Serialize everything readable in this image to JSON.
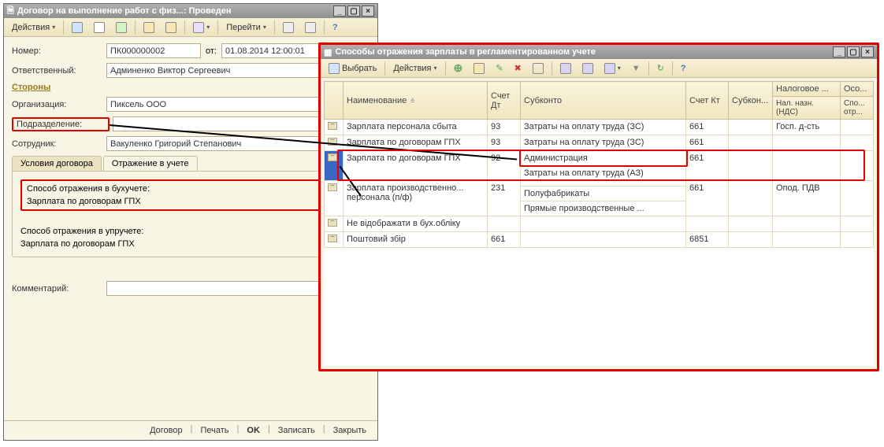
{
  "window1": {
    "title": "Договор на выполнение работ с физ...: Проведен",
    "toolbar": {
      "actions": "Действия",
      "goto": "Перейти"
    },
    "number_label": "Номер:",
    "number_value": "ПК000000002",
    "ot_label": "от:",
    "date_value": "01.08.2014 12:00:01",
    "responsible_label": "Ответственный:",
    "responsible_value": "Админенко Виктор Сергеевич",
    "sides_label": "Стороны",
    "org_label": "Организация:",
    "org_value": "Пиксель ООО",
    "dept_label": "Подразделение:",
    "dept_value": "",
    "emp_label": "Сотрудник:",
    "emp_value": "Вакуленко Григорий Степанович",
    "tab1": "Условия договора",
    "tab2": "Отражение в учете",
    "acc_method_label": "Способ отражения в бухучете:",
    "acc_method_value": "Зарплата по договорам ГПХ",
    "mgmt_method_label": "Способ отражения в упручете:",
    "mgmt_method_value": "Зарплата по договорам ГПХ",
    "comment_label": "Комментарий:",
    "comment_value": "",
    "footer": {
      "dogovor": "Договор",
      "print": "Печать",
      "ok": "OK",
      "write": "Записать",
      "close": "Закрыть"
    }
  },
  "window2": {
    "title": "Способы отражения зарплаты в регламентированном учете",
    "toolbar": {
      "choose": "Выбрать",
      "actions": "Действия"
    },
    "headers": {
      "name": "Наименование",
      "dt": "Счет Дт",
      "sub": "Субконто",
      "kt": "Счет Кт",
      "subkt": "Субкон...",
      "tax": "Налоговое ...",
      "oso": "Осо...",
      "nds": "Нал. назн. (НДС)",
      "spo": "Спо... отр..."
    },
    "rows": [
      {
        "name": "Зарплата персонала сбыта",
        "dt": "93",
        "sub": [
          "Затраты на оплату труда (ЗС)"
        ],
        "kt": "661",
        "tax": "Госп. д-сть"
      },
      {
        "name": "Зарплата по договорам ГПХ",
        "dt": "93",
        "sub": [
          "Затраты на оплату труда (ЗС)"
        ],
        "kt": "661",
        "tax": ""
      },
      {
        "name": "Зарплата по договорам ГПХ",
        "dt": "92",
        "sub": [
          "Администрация",
          "Затраты на оплату труда (АЗ)"
        ],
        "kt": "661",
        "tax": "",
        "selected": true
      },
      {
        "name": "Зарплата производственно... персонала (п/ф)",
        "dt": "231",
        "sub": [
          "",
          "Полуфабрикаты",
          "Прямые производственные ..."
        ],
        "kt": "661",
        "tax": "Опод. ПДВ"
      },
      {
        "name": "Не відображати в бух.обліку",
        "dt": "",
        "sub": [],
        "kt": "",
        "tax": ""
      },
      {
        "name": "Поштовий збір",
        "dt": "661",
        "sub": [],
        "kt": "6851",
        "tax": ""
      }
    ]
  }
}
